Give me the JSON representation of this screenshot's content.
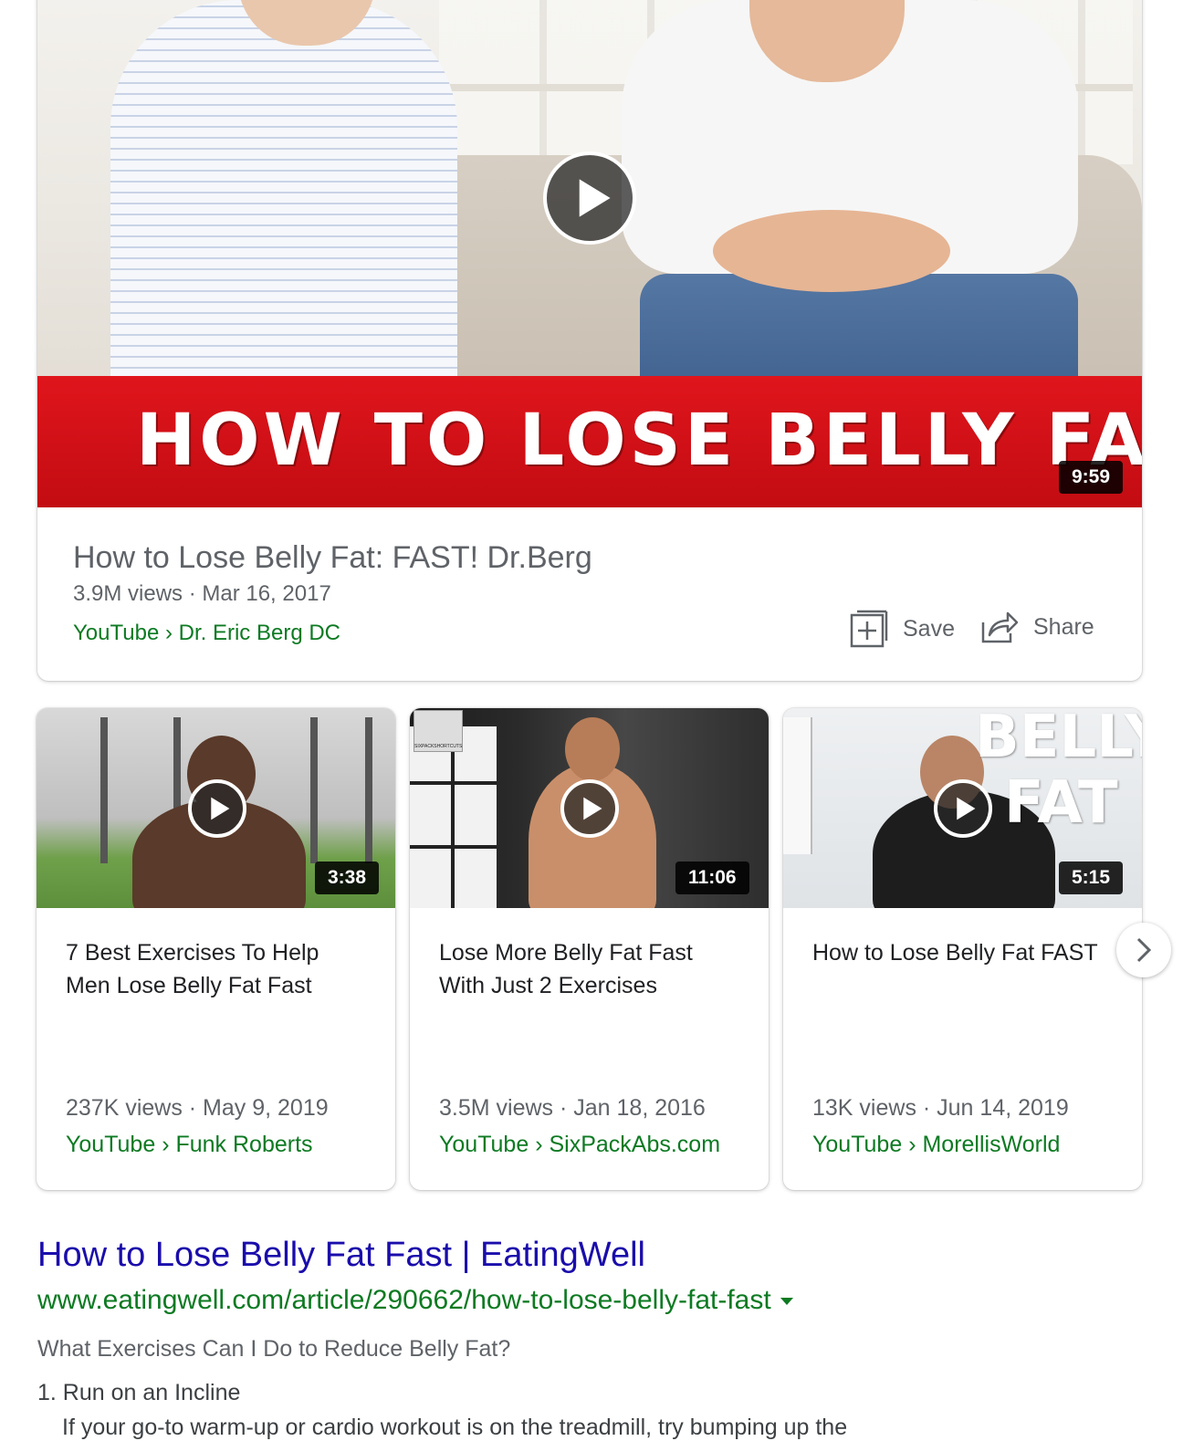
{
  "featured": {
    "banner_text": "HOW TO LOSE BELLY FAT",
    "duration": "9:59",
    "title": "How to Lose Belly Fat: FAST! Dr.Berg",
    "meta": "3.9M views · Mar 16, 2017",
    "source": "YouTube › Dr. Eric Berg DC",
    "save_label": "Save",
    "share_label": "Share",
    "icons": {
      "play": "play-icon",
      "save": "add-to-playlist-icon",
      "share": "share-icon"
    }
  },
  "videos": [
    {
      "title": "7 Best Exercises To Help Men Lose Belly Fat Fast",
      "duration": "3:38",
      "meta": "237K views · May 9, 2019",
      "source": "YouTube › Funk Roberts"
    },
    {
      "title": "Lose More Belly Fat Fast With Just 2 Exercises",
      "duration": "11:06",
      "meta": "3.5M views · Jan 18, 2016",
      "source": "YouTube › SixPackAbs.com",
      "thumb_badge": "SIXPACKSHORTCUTS.COM"
    },
    {
      "title": "How to Lose Belly Fat FAST",
      "duration": "5:15",
      "meta": "13K views · Jun 14, 2019",
      "source": "YouTube › MorellisWorld",
      "thumb_text": [
        "BELLY",
        "FAT"
      ]
    }
  ],
  "carousel": {
    "next_icon": "chevron-right-icon"
  },
  "result": {
    "title": "How to Lose Belly Fat Fast | EatingWell",
    "url": "www.eatingwell.com/article/290662/how-to-lose-belly-fat-fast",
    "snippet_heading": "What Exercises Can I Do to Reduce Belly Fat?",
    "list_item_1": "1. Run on an Incline",
    "list_item_1_text": "If your go-to warm-up or cardio workout is on the treadmill, try bumping up the"
  },
  "colors": {
    "link": "#1a0dab",
    "url_green": "#0d7a22",
    "muted": "#5f6368",
    "banner_red": "#d41117"
  }
}
